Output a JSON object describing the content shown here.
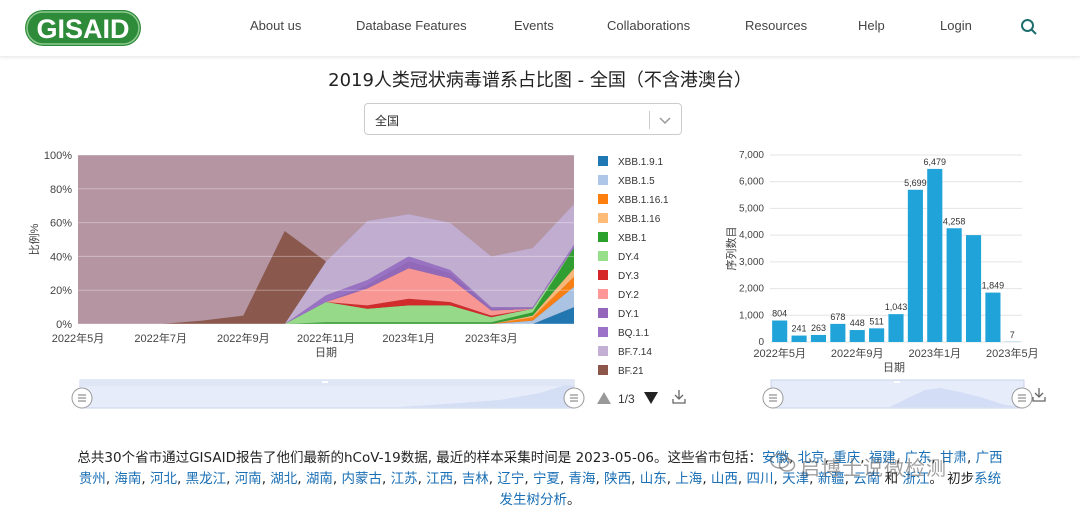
{
  "header": {
    "logo_text": "GISAID",
    "nav": [
      "About us",
      "Database Features",
      "Events",
      "Collaborations",
      "Resources",
      "Help",
      "Login"
    ],
    "search_icon": "search-icon"
  },
  "page_title": "2019人类冠状病毒谱系占比图 - 全国（不含港澳台）",
  "region_select": {
    "value": "全国"
  },
  "legend": {
    "items": [
      {
        "name": "XBB.1.9.1",
        "color": "#1f77b4"
      },
      {
        "name": "XBB.1.5",
        "color": "#aec7e8"
      },
      {
        "name": "XBB.1.16.1",
        "color": "#ff7f0e"
      },
      {
        "name": "XBB.1.16",
        "color": "#ffbb78"
      },
      {
        "name": "XBB.1",
        "color": "#2ca02c"
      },
      {
        "name": "DY.4",
        "color": "#98df8a"
      },
      {
        "name": "DY.3",
        "color": "#d62728"
      },
      {
        "name": "DY.2",
        "color": "#ff9896"
      },
      {
        "name": "DY.1",
        "color": "#9467bd"
      },
      {
        "name": "BQ.1.1",
        "color": "#9b72c8"
      },
      {
        "name": "BF.7.14",
        "color": "#c5b0d5"
      },
      {
        "name": "BF.21",
        "color": "#8c564b"
      }
    ],
    "page": "1/3"
  },
  "chart_data": [
    {
      "type": "area",
      "title": "",
      "ylabel": "比例%",
      "xlabel": "日期",
      "x_ticks": [
        "2022年5月",
        "2022年7月",
        "2022年9月",
        "2022年11月",
        "2023年1月",
        "2023年3月"
      ],
      "y_ticks": [
        "0%",
        "20%",
        "40%",
        "60%",
        "80%",
        "100%"
      ],
      "ylim": [
        0,
        100
      ],
      "x": [
        "2022-04",
        "2022-05",
        "2022-06",
        "2022-07",
        "2022-08",
        "2022-09",
        "2022-10",
        "2022-11",
        "2022-12",
        "2023-01",
        "2023-02",
        "2023-03",
        "2023-04"
      ],
      "series": [
        {
          "name": "XBB.1.9.1",
          "color": "#1f77b4",
          "values": [
            0,
            0,
            0,
            0,
            0,
            0,
            0,
            0,
            0,
            0,
            0,
            0,
            10
          ]
        },
        {
          "name": "XBB.1.5",
          "color": "#aec7e8",
          "values": [
            0,
            0,
            0,
            0,
            0,
            0,
            0,
            0,
            0,
            0,
            0,
            2,
            12
          ]
        },
        {
          "name": "XBB.1.16.1",
          "color": "#ff7f0e",
          "values": [
            0,
            0,
            0,
            0,
            0,
            0,
            0,
            0,
            0,
            0,
            0,
            2,
            6
          ]
        },
        {
          "name": "XBB.1.16",
          "color": "#ffbb78",
          "values": [
            0,
            0,
            0,
            0,
            0,
            0,
            0,
            0,
            0,
            0,
            0,
            1,
            5
          ]
        },
        {
          "name": "XBB.1",
          "color": "#2ca02c",
          "values": [
            0,
            0,
            0,
            0,
            0,
            0,
            1,
            1,
            1,
            1,
            1,
            2,
            12
          ]
        },
        {
          "name": "DY.4",
          "color": "#98df8a",
          "values": [
            0,
            0,
            0,
            0,
            0,
            0,
            12,
            8,
            10,
            10,
            3,
            2,
            0
          ]
        },
        {
          "name": "DY.3",
          "color": "#d62728",
          "values": [
            0,
            0,
            0,
            0,
            0,
            0,
            0,
            2,
            4,
            2,
            1,
            0,
            0
          ]
        },
        {
          "name": "DY.2",
          "color": "#ff9896",
          "values": [
            0,
            0,
            0,
            0,
            0,
            0,
            0,
            10,
            18,
            14,
            3,
            0,
            0
          ]
        },
        {
          "name": "DY.1",
          "color": "#9467bd",
          "values": [
            0,
            0,
            0,
            0,
            0,
            0,
            0,
            2,
            4,
            3,
            1,
            0,
            0
          ]
        },
        {
          "name": "BQ.1.1",
          "color": "#9b72c8",
          "values": [
            0,
            0,
            0,
            0,
            0,
            0,
            4,
            3,
            3,
            2,
            1,
            1,
            2
          ]
        },
        {
          "name": "BF.7.14",
          "color": "#c5b0d5",
          "values": [
            0,
            0,
            0,
            0,
            0,
            0,
            20,
            35,
            25,
            28,
            30,
            35,
            24
          ]
        },
        {
          "name": "BF.21",
          "color": "#8c564b",
          "values": [
            0,
            0,
            0,
            2,
            5,
            55,
            0,
            0,
            0,
            0,
            0,
            0,
            0
          ]
        }
      ]
    },
    {
      "type": "bar",
      "title": "",
      "ylabel": "序列数目",
      "xlabel": "日期",
      "color": "#1fa3d8",
      "x_ticks": [
        "2022年5月",
        "2022年9月",
        "2023年1月",
        "2023年5月"
      ],
      "y_ticks": [
        "0",
        "1,000",
        "2,000",
        "3,000",
        "4,000",
        "5,000",
        "6,000",
        "7,000"
      ],
      "ylim": [
        0,
        7000
      ],
      "categories": [
        "2022-05",
        "2022-06",
        "2022-07",
        "2022-08",
        "2022-09",
        "2022-10",
        "2022-11",
        "2022-12",
        "2023-01",
        "2023-02",
        "2023-03",
        "2023-04",
        "2023-05"
      ],
      "values": [
        804,
        241,
        263,
        678,
        448,
        511,
        1043,
        5699,
        6479,
        4258,
        4000,
        1849,
        7
      ],
      "labels": [
        "804",
        "241",
        "263",
        "678",
        "448",
        "511",
        "1,043",
        "5,699",
        "6,479",
        "4,258",
        "",
        "1,849",
        "7"
      ]
    }
  ],
  "footer": {
    "text1": "总共30个省市通过GISAID报告了他们最新的hCoV-19数据, 最近的样本采集时间是 2023-05-06。这些省市包括：",
    "line1_links": [
      "安徽",
      "北京",
      "重庆",
      "福建",
      "广东",
      "甘肃",
      "广西"
    ],
    "line2_links": [
      "贵州",
      "海南",
      "河北",
      "黑龙江",
      "河南",
      "湖北",
      "湖南",
      "内蒙古",
      "江苏",
      "江西",
      "吉林",
      "辽宁",
      "宁夏",
      "青海",
      "陕西",
      "山东",
      "上海",
      "山西",
      "四川",
      "天津",
      "新疆",
      "云南"
    ],
    "and_word": "和",
    "last_link": "浙江",
    "text2": "。 初步",
    "line2_tail_link": "系统",
    "line3_link": "发生树分析",
    "line3_tail": "。"
  },
  "watermark": "启博士说微检测"
}
